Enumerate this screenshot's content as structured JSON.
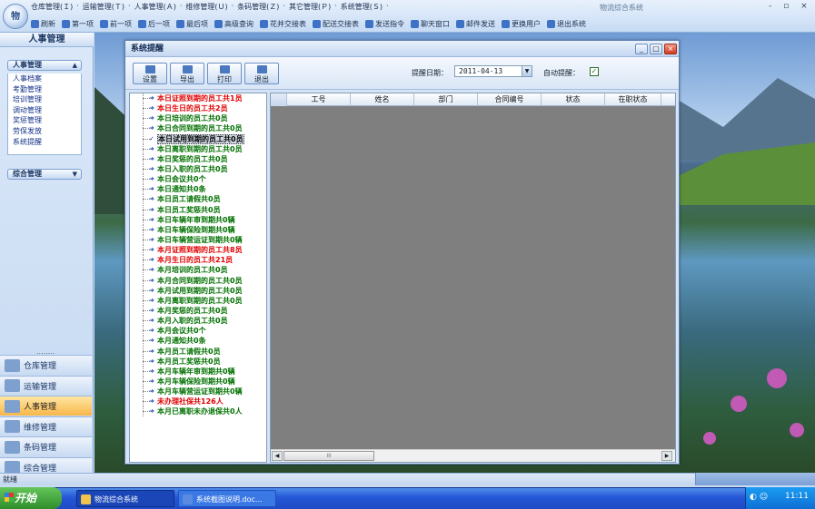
{
  "app": {
    "orb_label": "物",
    "title": "物流综合系统",
    "window_controls": "- ▫ ×"
  },
  "menu": [
    "仓库管理(Ｉ)",
    "运输管理(Ｔ)",
    "人事管理(Ａ)",
    "维修管理(Ｕ)",
    "条码管理(Ｚ)",
    "其它管理(Ｐ)",
    "系统管理(Ｓ)"
  ],
  "toolbar": [
    {
      "icon": "refresh-icon",
      "label": "刷新"
    },
    {
      "icon": "first-icon",
      "label": "第一项"
    },
    {
      "icon": "prev-icon",
      "label": "前一项"
    },
    {
      "icon": "next-icon",
      "label": "后一项"
    },
    {
      "icon": "last-icon",
      "label": "最后项"
    },
    {
      "icon": "query-icon",
      "label": "高级查询"
    },
    {
      "icon": "shift-icon",
      "label": "花并交接表"
    },
    {
      "icon": "handover-icon",
      "label": "配送交接表"
    },
    {
      "icon": "send-icon",
      "label": "发送指令"
    },
    {
      "icon": "chat-icon",
      "label": "聊天窗口"
    },
    {
      "icon": "mail-icon",
      "label": "邮件发送"
    },
    {
      "icon": "user-switch-icon",
      "label": "更换用户"
    },
    {
      "icon": "exit-icon",
      "label": "退出系统"
    }
  ],
  "left_panel": {
    "title": "人事管理",
    "group1_title": "人事管理",
    "group1_items": [
      "人事档案",
      "考勤管理",
      "培训管理",
      "调动管理",
      "奖惩管理",
      "劳保发放",
      "系统提醒"
    ],
    "group2_title": "综合管理",
    "grip": "........",
    "nav_buttons": [
      {
        "label": "仓库管理",
        "active": false
      },
      {
        "label": "运输管理",
        "active": false
      },
      {
        "label": "人事管理",
        "active": true
      },
      {
        "label": "维修管理",
        "active": false
      },
      {
        "label": "条码管理",
        "active": false
      },
      {
        "label": "综合管理",
        "active": false
      }
    ]
  },
  "dialog": {
    "title": "系统提醒",
    "buttons": [
      "设置",
      "导出",
      "打印",
      "退出"
    ],
    "date_label": "提醒日期：",
    "date_value": "2011-04-13",
    "auto_label": "自动提醒：",
    "auto_checked": true,
    "tree": [
      {
        "text": "本日证照到期的员工共1员",
        "color": "red"
      },
      {
        "text": "本日生日的员工共2员",
        "color": "red"
      },
      {
        "text": "本日培训的员工共0员",
        "color": "green"
      },
      {
        "text": "本日合同到期的员工共0员",
        "color": "green"
      },
      {
        "text": "本日试用到期的员工共0员",
        "color": "green",
        "selected": true
      },
      {
        "text": "本日离职到期的员工共0员",
        "color": "green"
      },
      {
        "text": "本日奖惩的员工共0员",
        "color": "green"
      },
      {
        "text": "本日入职的员工共0员",
        "color": "green"
      },
      {
        "text": "本日会议共0个",
        "color": "green"
      },
      {
        "text": "本日通知共0条",
        "color": "green"
      },
      {
        "text": "本日员工请假共0员",
        "color": "green"
      },
      {
        "text": "本日员工奖惩共0员",
        "color": "green"
      },
      {
        "text": "本日车辆年审到期共0辆",
        "color": "green"
      },
      {
        "text": "本日车辆保险到期共0辆",
        "color": "green"
      },
      {
        "text": "本日车辆营运证到期共0辆",
        "color": "green"
      },
      {
        "text": "本月证照到期的员工共8员",
        "color": "red"
      },
      {
        "text": "本月生日的员工共21员",
        "color": "red"
      },
      {
        "text": "本月培训的员工共0员",
        "color": "green"
      },
      {
        "text": "本月合同到期的员工共0员",
        "color": "green"
      },
      {
        "text": "本月试用到期的员工共0员",
        "color": "green"
      },
      {
        "text": "本月离职到期的员工共0员",
        "color": "green"
      },
      {
        "text": "本月奖惩的员工共0员",
        "color": "green"
      },
      {
        "text": "本月入职的员工共0员",
        "color": "green"
      },
      {
        "text": "本月会议共0个",
        "color": "green"
      },
      {
        "text": "本月通知共0条",
        "color": "green"
      },
      {
        "text": "本月员工请假共0员",
        "color": "green"
      },
      {
        "text": "本月员工奖惩共0员",
        "color": "green"
      },
      {
        "text": "本月车辆年审到期共0辆",
        "color": "green"
      },
      {
        "text": "本月车辆保险到期共0辆",
        "color": "green"
      },
      {
        "text": "本月车辆营运证到期共0辆",
        "color": "green"
      },
      {
        "text": "未办理社保共126人",
        "color": "red"
      },
      {
        "text": "本月已离职未办退保共0人",
        "color": "green"
      }
    ],
    "grid_columns": [
      "",
      "工号",
      "姓名",
      "部门",
      "合同编号",
      "状态",
      "在职状态"
    ],
    "scroll_thumb": "III"
  },
  "status": {
    "text": "就绪"
  },
  "taskbar": {
    "start": "开始",
    "tasks": [
      "物流综合系统",
      "系统截图说明.doc..."
    ],
    "clock": "11:11"
  },
  "colors": {
    "red": "#e00000",
    "green": "#007000",
    "accent": "#2456d6"
  }
}
